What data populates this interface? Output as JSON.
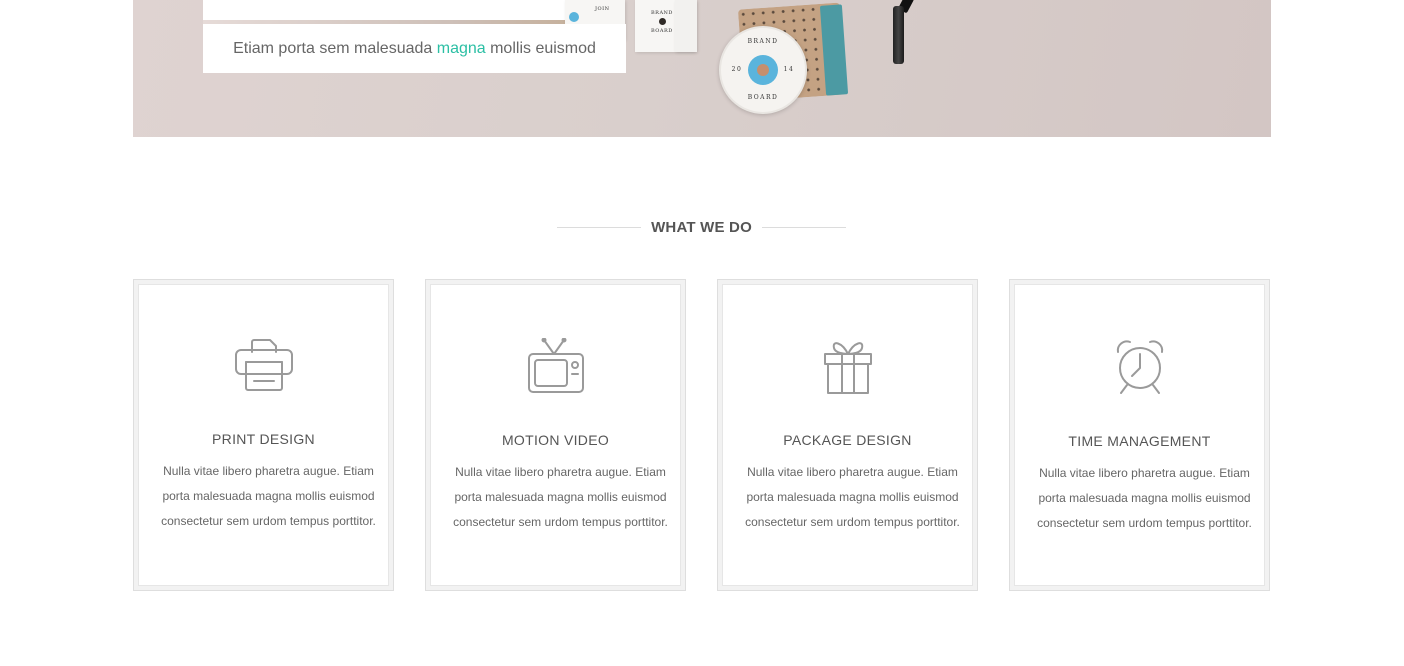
{
  "hero": {
    "caption_before": "Etiam porta sem malesuada ",
    "caption_accent": "magna",
    "caption_after": " mollis euismod",
    "accent_color": "#2bbfa4",
    "mockup": {
      "card_text_1": "BRAND",
      "card_text_2": "BOARD",
      "disc_text_top": "BRAND",
      "disc_text_bottom": "BOARD",
      "disc_left_num": "20",
      "disc_right_num": "14",
      "partial_card_text": "JOIN"
    }
  },
  "section": {
    "title": "WHAT WE DO"
  },
  "services": [
    {
      "icon": "printer-icon",
      "title": "PRINT DESIGN",
      "text": "Nulla vitae libero pharetra augue. Etiam porta malesuada magna mollis euismod consectetur sem urdom tempus porttitor."
    },
    {
      "icon": "tv-icon",
      "title": "MOTION VIDEO",
      "text": "Nulla vitae libero pharetra augue. Etiam porta malesuada magna mollis euismod consectetur sem urdom tempus porttitor."
    },
    {
      "icon": "gift-icon",
      "title": "PACKAGE DESIGN",
      "text": "Nulla vitae libero pharetra augue. Etiam porta malesuada magna mollis euismod consectetur sem urdom tempus porttitor."
    },
    {
      "icon": "alarm-clock-icon",
      "title": "TIME MANAGEMENT",
      "text": "Nulla vitae libero pharetra augue. Etiam porta malesuada magna mollis euismod consectetur sem urdom tempus porttitor."
    }
  ],
  "colors": {
    "icon_stroke": "#9a9a9a",
    "card_border": "#dedede",
    "heading_text": "#555555"
  }
}
